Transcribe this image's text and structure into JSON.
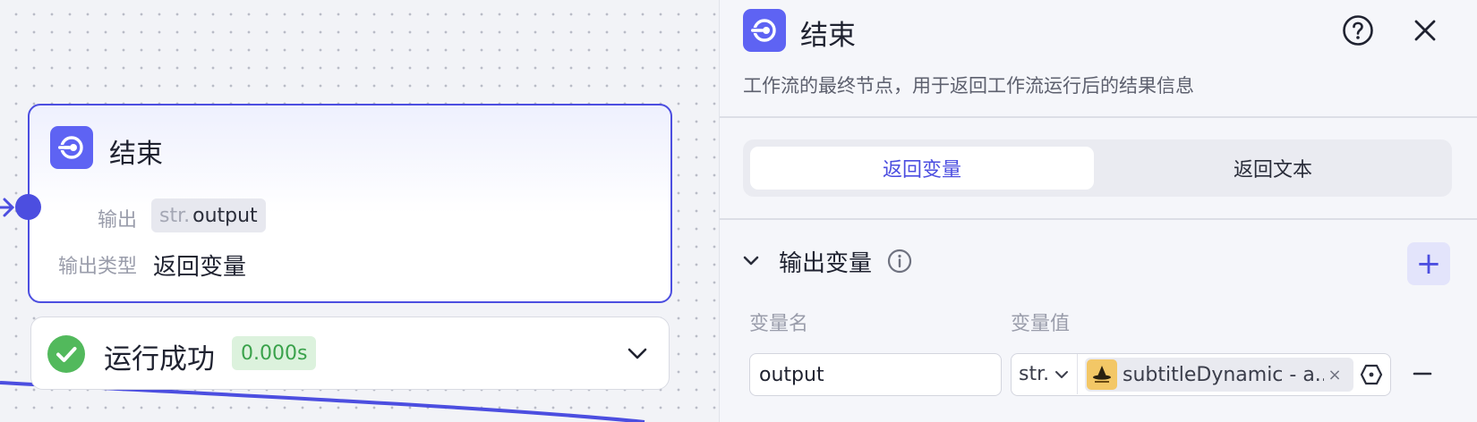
{
  "canvas": {
    "node": {
      "title": "结束",
      "output_label": "输出",
      "output_type_prefix": "str.",
      "output_var_name": "output",
      "type_label": "输出类型",
      "type_value": "返回变量"
    },
    "status": {
      "text": "运行成功",
      "duration": "0.000s"
    }
  },
  "panel": {
    "title": "结束",
    "description": "工作流的最终节点，用于返回工作流运行后的结果信息",
    "tabs": [
      {
        "label": "返回变量",
        "active": true
      },
      {
        "label": "返回文本",
        "active": false
      }
    ],
    "section": {
      "title": "输出变量",
      "add_label": "+",
      "columns": {
        "name": "变量名",
        "value": "变量值"
      },
      "rows": [
        {
          "name": "output",
          "type": "str.",
          "ref_text": "subtitleDynamic - a..",
          "clear_label": "×"
        }
      ]
    }
  },
  "colors": {
    "accent": "#4c4ee0",
    "node_icon": "#5e63f3",
    "success": "#3aa24b",
    "success_bg": "#dcf2dd"
  },
  "icons": [
    "end-node-icon",
    "check-circle-icon",
    "chevron-down-icon",
    "help-icon",
    "close-icon",
    "info-icon",
    "plus-icon",
    "minus-icon",
    "variable-picker-icon",
    "plugin-avatar-icon",
    "arrow-right-icon"
  ]
}
